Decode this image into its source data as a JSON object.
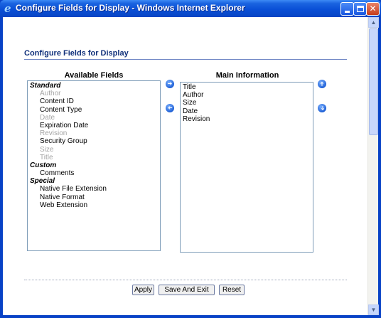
{
  "window": {
    "title": "Configure Fields for Display - Windows Internet Explorer",
    "icon": "ie-e-icon"
  },
  "page": {
    "title": "Configure Fields for Display"
  },
  "available": {
    "header": "Available Fields",
    "rows": [
      {
        "label": "Standard",
        "kind": "group"
      },
      {
        "label": "Author",
        "kind": "item",
        "disabled": true
      },
      {
        "label": "Content ID",
        "kind": "item",
        "disabled": false
      },
      {
        "label": "Content Type",
        "kind": "item",
        "disabled": false
      },
      {
        "label": "Date",
        "kind": "item",
        "disabled": true
      },
      {
        "label": "Expiration Date",
        "kind": "item",
        "disabled": false
      },
      {
        "label": "Revision",
        "kind": "item",
        "disabled": true
      },
      {
        "label": "Security Group",
        "kind": "item",
        "disabled": false
      },
      {
        "label": "Size",
        "kind": "item",
        "disabled": true
      },
      {
        "label": "Title",
        "kind": "item",
        "disabled": true
      },
      {
        "label": "Custom",
        "kind": "group"
      },
      {
        "label": "Comments",
        "kind": "item",
        "disabled": false
      },
      {
        "label": "Special",
        "kind": "group"
      },
      {
        "label": "Native File Extension",
        "kind": "item",
        "disabled": false
      },
      {
        "label": "Native Format",
        "kind": "item",
        "disabled": false
      },
      {
        "label": "Web Extension",
        "kind": "item",
        "disabled": false
      }
    ]
  },
  "main": {
    "header": "Main Information",
    "rows": [
      "Title",
      "Author",
      "Size",
      "Date",
      "Revision"
    ]
  },
  "buttons": {
    "apply": "Apply",
    "save_exit": "Save And Exit",
    "reset": "Reset"
  },
  "colors": {
    "title_bar": "#0a4fd6",
    "page_title": "#10307a",
    "disabled_text": "#a4a4a4",
    "arrow_button": "#1d5fd6"
  }
}
